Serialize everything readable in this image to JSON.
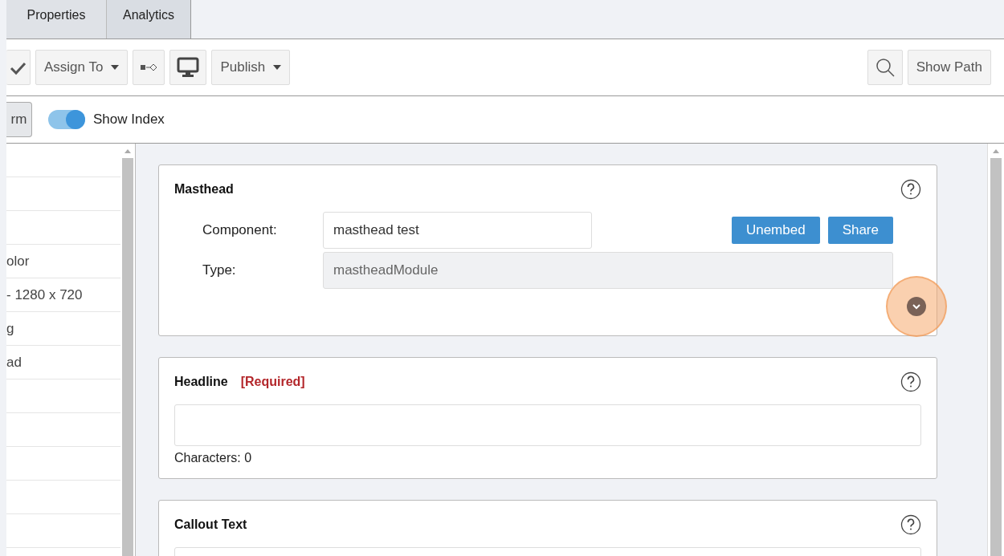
{
  "tabs": [
    {
      "label": "Properties",
      "selected": false
    },
    {
      "label": "Analytics",
      "selected": true
    }
  ],
  "toolbar": {
    "assign": "Assign To",
    "publish": "Publish",
    "show_path": "Show Path"
  },
  "subbar": {
    "cut_button": "rm",
    "toggle": {
      "label": "Show Index",
      "on": true
    }
  },
  "sidebar": {
    "items": [
      {
        "label": "olor"
      },
      {
        "label": "- 1280 x 720"
      },
      {
        "label": "g"
      },
      {
        "label": "ad"
      }
    ]
  },
  "sections": [
    {
      "kind": "component",
      "title": "Masthead",
      "component_label": "Component:",
      "component_value": "masthead test",
      "type_label": "Type:",
      "type_value": "mastheadModule",
      "buttons": [
        "Unembed",
        "Share"
      ]
    },
    {
      "kind": "text",
      "title": "Headline",
      "required": "[Required]",
      "counter": "Characters: 0"
    },
    {
      "kind": "text",
      "title": "Callout Text"
    }
  ]
}
